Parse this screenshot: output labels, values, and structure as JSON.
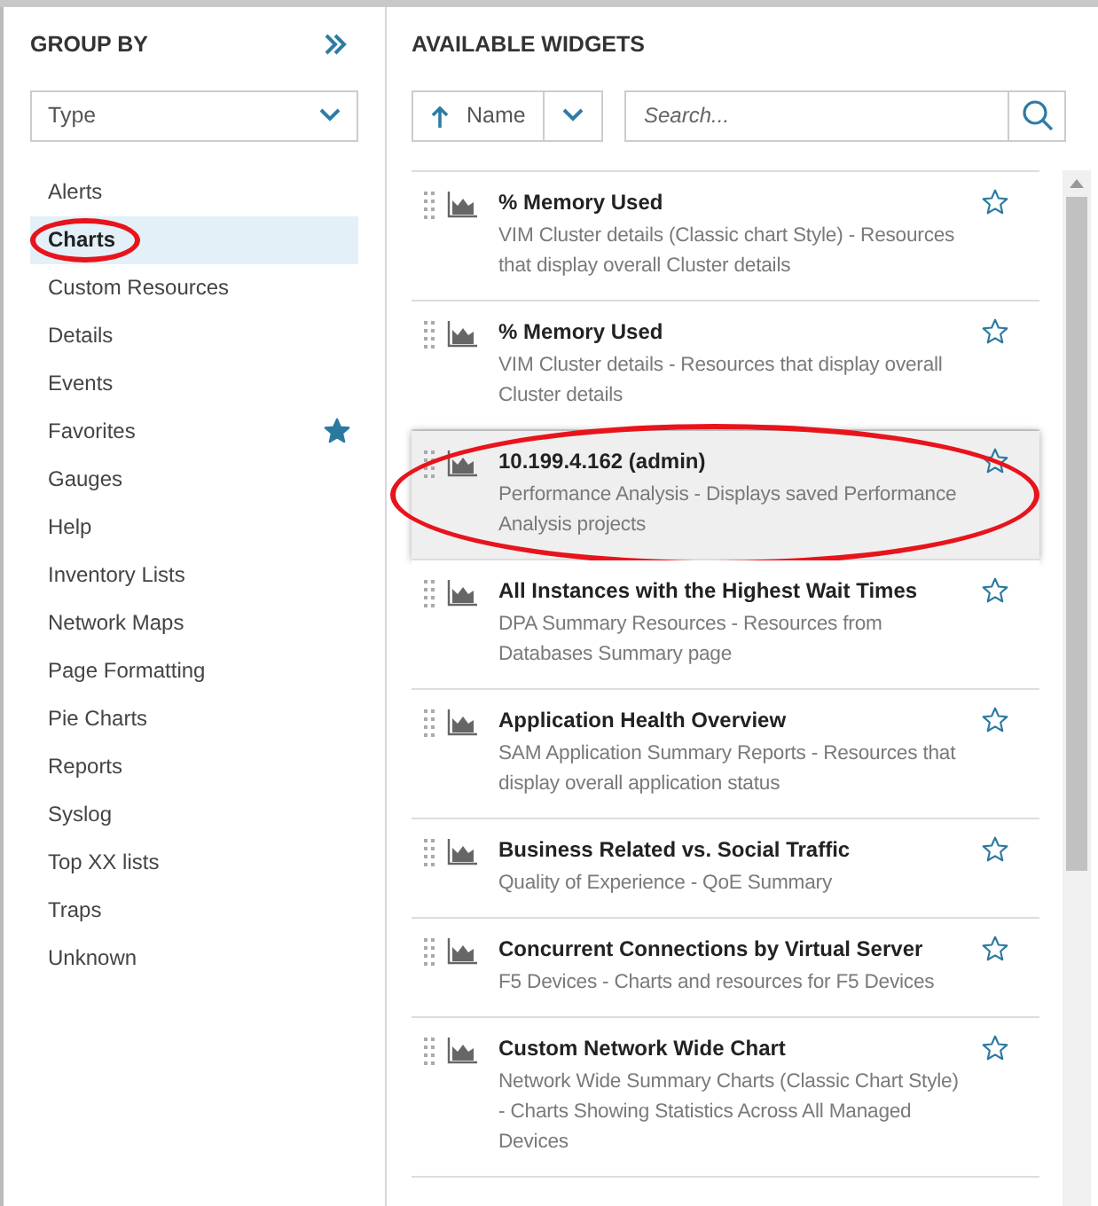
{
  "group_by": {
    "title": "GROUP BY",
    "dropdown": {
      "value": "Type"
    },
    "items": [
      {
        "label": "Alerts",
        "selected": false,
        "circled": false,
        "favorite": false
      },
      {
        "label": "Charts",
        "selected": true,
        "circled": true,
        "favorite": false
      },
      {
        "label": "Custom Resources",
        "selected": false,
        "circled": false,
        "favorite": false
      },
      {
        "label": "Details",
        "selected": false,
        "circled": false,
        "favorite": false
      },
      {
        "label": "Events",
        "selected": false,
        "circled": false,
        "favorite": false
      },
      {
        "label": "Favorites",
        "selected": false,
        "circled": false,
        "favorite": true
      },
      {
        "label": "Gauges",
        "selected": false,
        "circled": false,
        "favorite": false
      },
      {
        "label": "Help",
        "selected": false,
        "circled": false,
        "favorite": false
      },
      {
        "label": "Inventory Lists",
        "selected": false,
        "circled": false,
        "favorite": false
      },
      {
        "label": "Network Maps",
        "selected": false,
        "circled": false,
        "favorite": false
      },
      {
        "label": "Page Formatting",
        "selected": false,
        "circled": false,
        "favorite": false
      },
      {
        "label": "Pie Charts",
        "selected": false,
        "circled": false,
        "favorite": false
      },
      {
        "label": "Reports",
        "selected": false,
        "circled": false,
        "favorite": false
      },
      {
        "label": "Syslog",
        "selected": false,
        "circled": false,
        "favorite": false
      },
      {
        "label": "Top XX lists",
        "selected": false,
        "circled": false,
        "favorite": false
      },
      {
        "label": "Traps",
        "selected": false,
        "circled": false,
        "favorite": false
      },
      {
        "label": "Unknown",
        "selected": false,
        "circled": false,
        "favorite": false
      }
    ]
  },
  "widgets": {
    "title": "AVAILABLE WIDGETS",
    "sort": {
      "label": "Name"
    },
    "search": {
      "placeholder": "Search..."
    },
    "items": [
      {
        "title": "% Memory Used",
        "description": "VIM Cluster details (Classic chart Style) - Resources that display overall Cluster details",
        "highlighted": false,
        "circled": false
      },
      {
        "title": "% Memory Used",
        "description": "VIM Cluster details - Resources that display overall Cluster details",
        "highlighted": false,
        "circled": false
      },
      {
        "title": "10.199.4.162 (admin)",
        "description": "Performance Analysis - Displays saved Performance Analysis projects",
        "highlighted": true,
        "circled": true
      },
      {
        "title": "All Instances with the Highest Wait Times",
        "description": "DPA Summary Resources - Resources from Databases Summary page",
        "highlighted": false,
        "circled": false
      },
      {
        "title": "Application Health Overview",
        "description": "SAM Application Summary Reports - Resources that display overall application status",
        "highlighted": false,
        "circled": false
      },
      {
        "title": "Business Related vs. Social Traffic",
        "description": "Quality of Experience - QoE Summary",
        "highlighted": false,
        "circled": false
      },
      {
        "title": "Concurrent Connections by Virtual Server",
        "description": "F5 Devices - Charts and resources for F5 Devices",
        "highlighted": false,
        "circled": false
      },
      {
        "title": "Custom Network Wide Chart",
        "description": "Network Wide Summary Charts (Classic Chart Style) - Charts Showing Statistics Across All Managed Devices",
        "highlighted": false,
        "circled": false
      }
    ]
  }
}
